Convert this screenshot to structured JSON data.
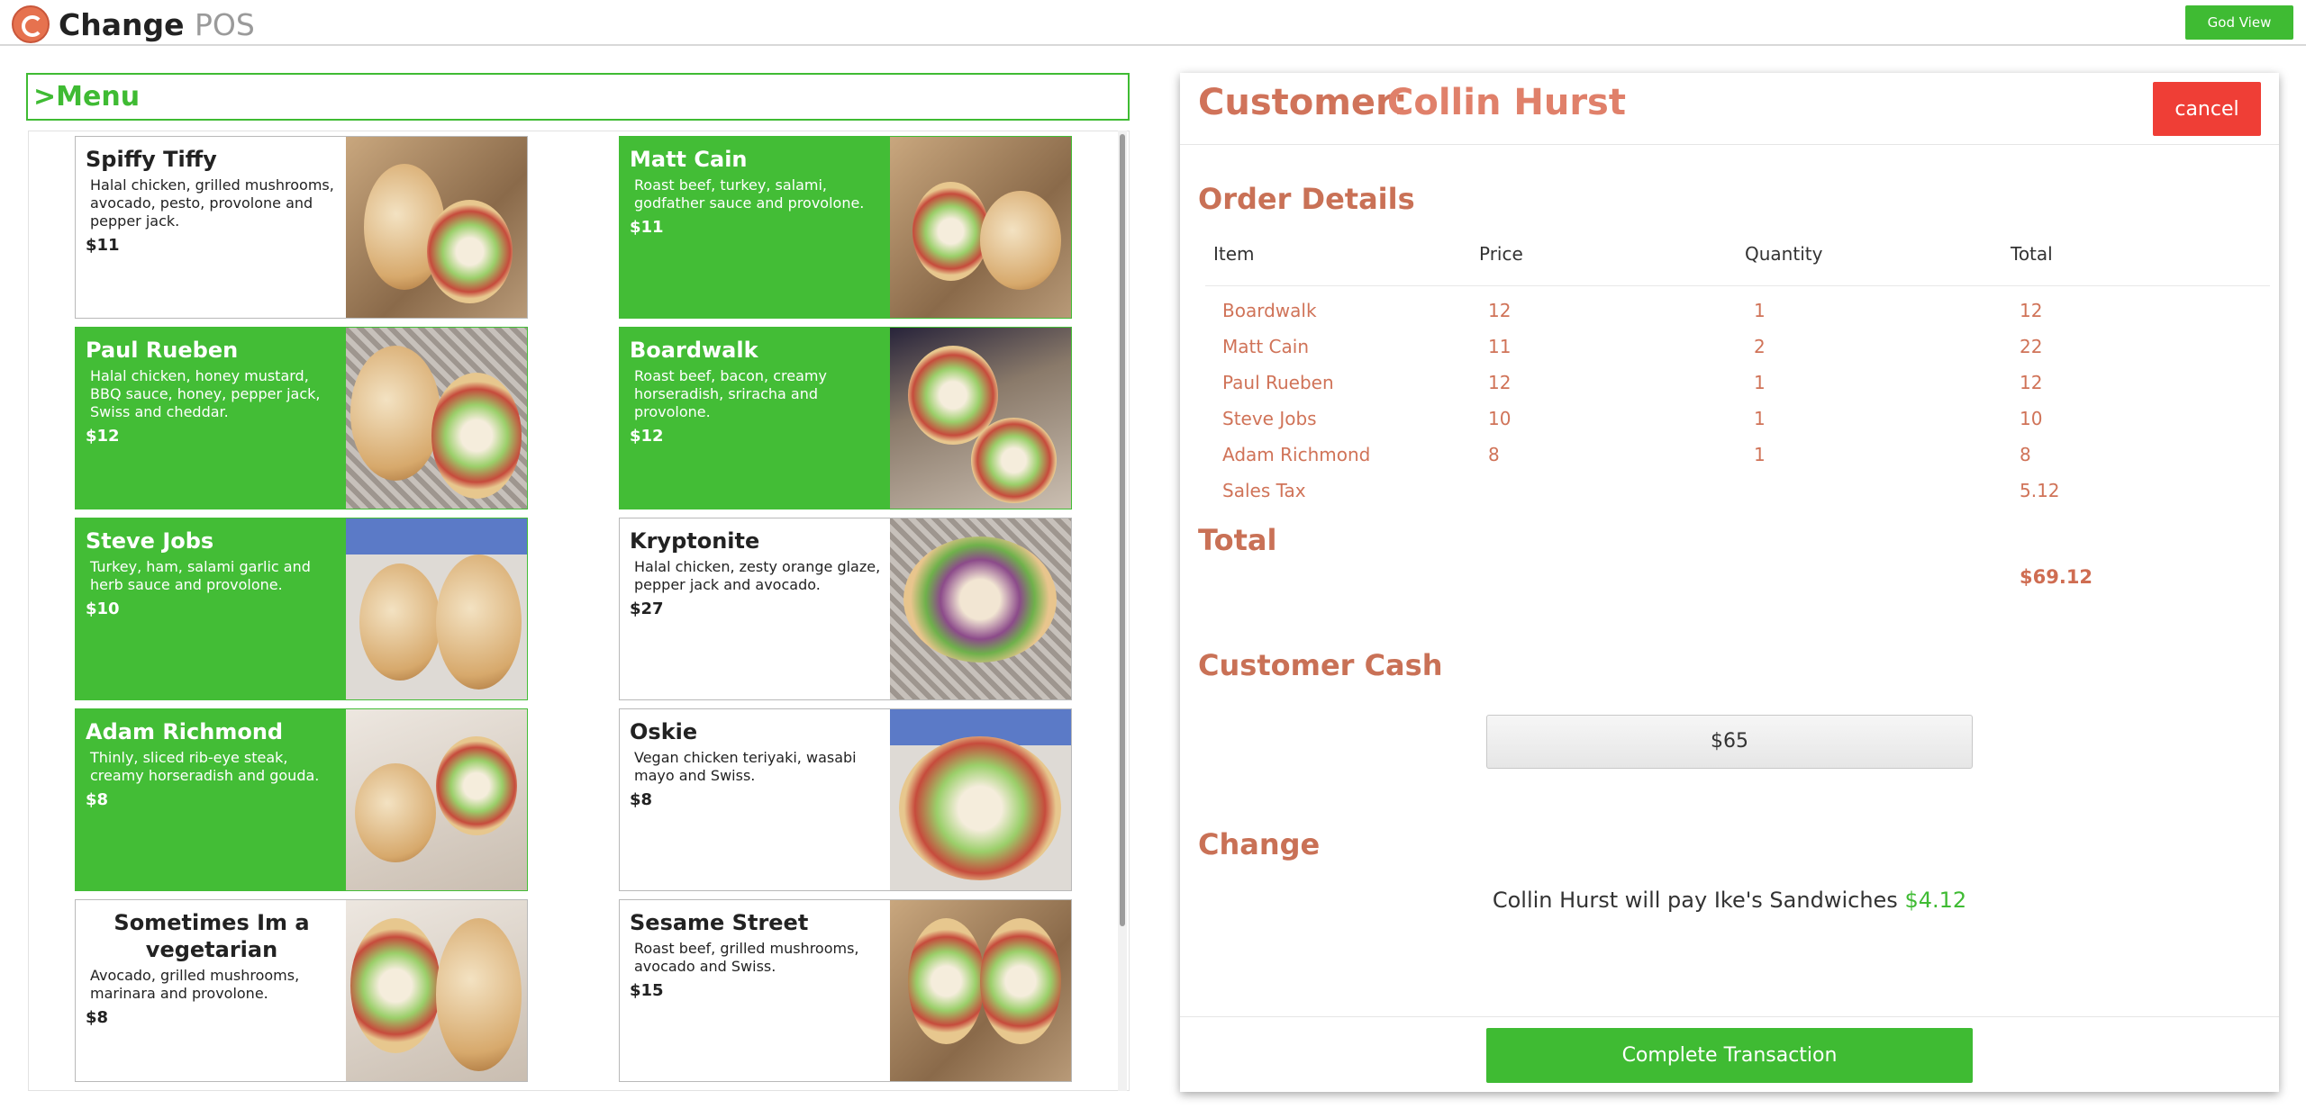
{
  "app": {
    "name": "Change",
    "name_suffix": "POS",
    "god_view_label": "God View"
  },
  "menu": {
    "title": ">Menu",
    "items": [
      {
        "name": "Spiffy Tiffy",
        "desc": "Halal chicken, grilled mushrooms, avocado, pesto, provolone and pepper jack.",
        "price": "$11",
        "selected": false
      },
      {
        "name": "Matt Cain",
        "desc": "Roast beef, turkey, salami, godfather sauce and provolone.",
        "price": "$11",
        "selected": true
      },
      {
        "name": "Paul Rueben",
        "desc": "Halal chicken, honey mustard, BBQ sauce, honey, pepper jack, Swiss and cheddar.",
        "price": "$12",
        "selected": true
      },
      {
        "name": "Boardwalk",
        "desc": "Roast beef, bacon, creamy horseradish, sriracha and provolone.",
        "price": "$12",
        "selected": true
      },
      {
        "name": "Steve Jobs",
        "desc": "Turkey, ham, salami garlic and herb sauce and provolone.",
        "price": "$10",
        "selected": true
      },
      {
        "name": "Kryptonite",
        "desc": "Halal chicken, zesty orange glaze, pepper jack and avocado.",
        "price": "$27",
        "selected": false
      },
      {
        "name": "Adam Richmond",
        "desc": "Thinly, sliced rib-eye steak, creamy horseradish and gouda.",
        "price": "$8",
        "selected": true
      },
      {
        "name": "Oskie",
        "desc": "Vegan chicken teriyaki, wasabi mayo and Swiss.",
        "price": "$8",
        "selected": false
      },
      {
        "name": "Sometimes Im a vegetarian",
        "desc": "Avocado, grilled mushrooms, marinara and provolone.",
        "price": "$8",
        "selected": false
      },
      {
        "name": "Sesame Street",
        "desc": "Roast beef, grilled mushrooms, avocado and Swiss.",
        "price": "$15",
        "selected": false
      }
    ]
  },
  "order": {
    "customer_label": "Customer:",
    "customer_name": "Collin Hurst",
    "cancel_label": "cancel",
    "details_title": "Order Details",
    "columns": [
      "Item",
      "Price",
      "Quantity",
      "Total"
    ],
    "rows": [
      {
        "item": "Boardwalk",
        "price": "12",
        "qty": "1",
        "total": "12"
      },
      {
        "item": "Matt Cain",
        "price": "11",
        "qty": "2",
        "total": "22"
      },
      {
        "item": "Paul Rueben",
        "price": "12",
        "qty": "1",
        "total": "12"
      },
      {
        "item": "Steve Jobs",
        "price": "10",
        "qty": "1",
        "total": "10"
      },
      {
        "item": "Adam Richmond",
        "price": "8",
        "qty": "1",
        "total": "8"
      },
      {
        "item": "Sales Tax",
        "price": "",
        "qty": "",
        "total": "5.12"
      }
    ],
    "total_title": "Total",
    "total_value": "$69.12",
    "cash_title": "Customer Cash",
    "cash_value": "$65",
    "change_title": "Change",
    "change_text": "Collin Hurst will pay Ike's Sandwiches",
    "change_amount": "$4.12",
    "complete_label": "Complete Transaction"
  },
  "colors": {
    "accent_green": "#3fbb33",
    "order_text": "#d07358",
    "cancel_red": "#ef3e36"
  }
}
